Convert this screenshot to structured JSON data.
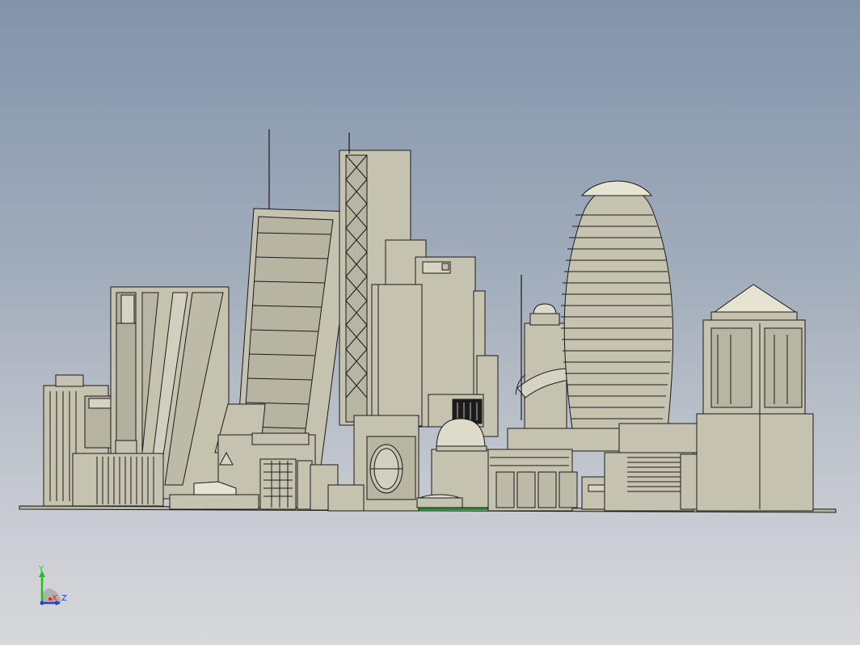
{
  "viewport": {
    "background_top": "#8293aa",
    "background_bottom": "#d7d8dc",
    "model_fill": "#c5c2b0",
    "model_shade": "#a9a694",
    "edge_color": "#1a1a1a"
  },
  "triad": {
    "y_label": "Y",
    "x_label": "X",
    "z_label": "Z",
    "y_color": "#1ec21e",
    "x_color": "#e02020",
    "z_color": "#2040e0",
    "icon": "coordinate-triad-icon"
  }
}
